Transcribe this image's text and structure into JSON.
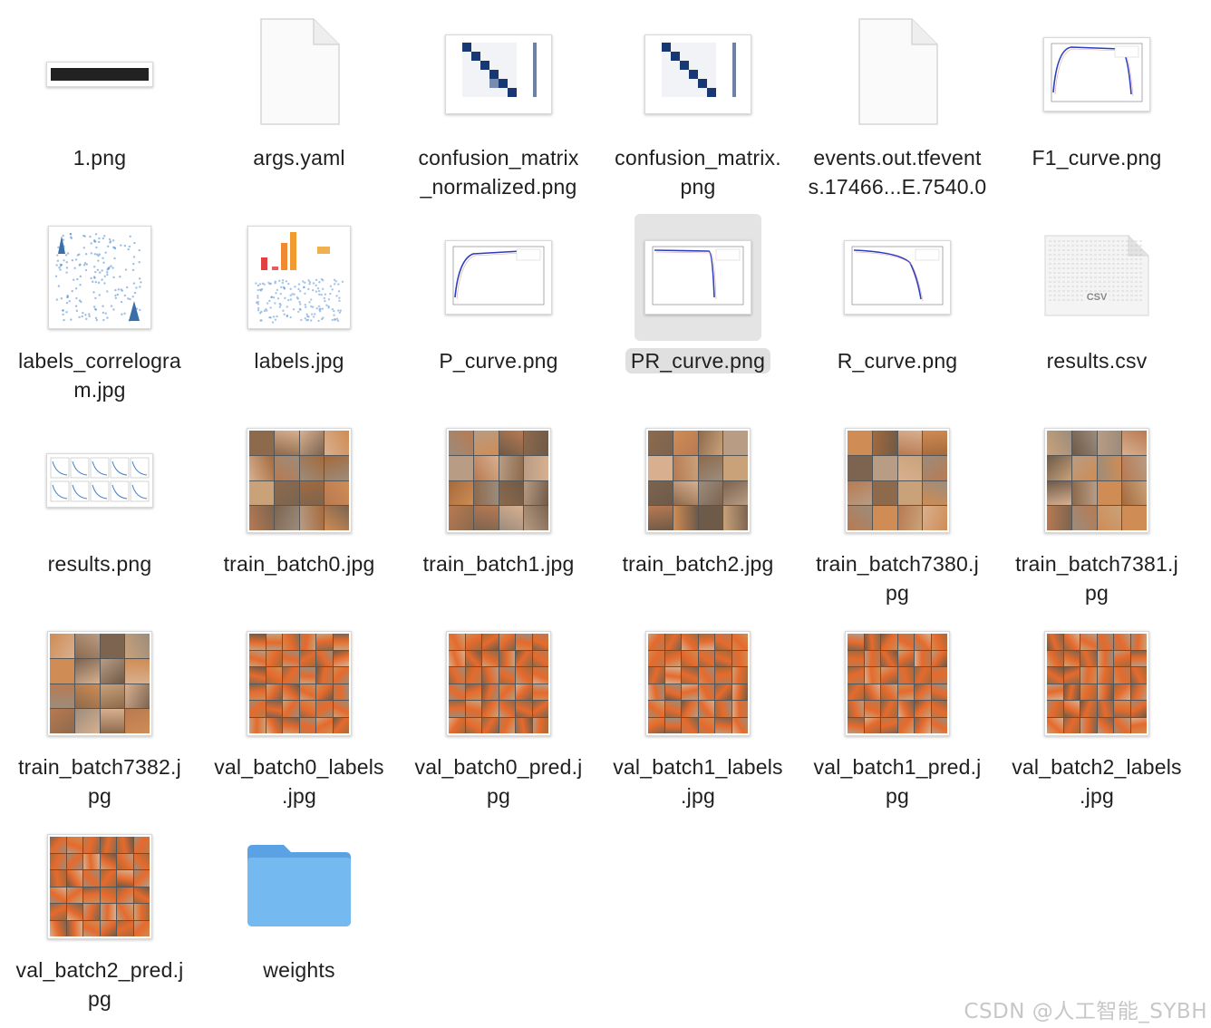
{
  "files": [
    {
      "name": "1.png",
      "label_lines": [
        "1.png"
      ],
      "kind": "image-strip"
    },
    {
      "name": "args.yaml",
      "label_lines": [
        "args.yaml"
      ],
      "kind": "document"
    },
    {
      "name": "confusion_matrix_normalized.png",
      "label_lines": [
        "confusion_matrix",
        "_normalized.png"
      ],
      "kind": "matrix"
    },
    {
      "name": "confusion_matrix.png",
      "label_lines": [
        "confusion_matrix.",
        "png"
      ],
      "kind": "matrix"
    },
    {
      "name": "events.out.tfevents.17466...E.7540.0",
      "label_lines": [
        "events.out.tfevent",
        "s.17466...E.7540.0"
      ],
      "kind": "document"
    },
    {
      "name": "F1_curve.png",
      "label_lines": [
        "F1_curve.png"
      ],
      "kind": "curve"
    },
    {
      "name": "labels_correlogram.jpg",
      "label_lines": [
        "labels_correlogra",
        "m.jpg"
      ],
      "kind": "correlogram"
    },
    {
      "name": "labels.jpg",
      "label_lines": [
        "labels.jpg"
      ],
      "kind": "labels"
    },
    {
      "name": "P_curve.png",
      "label_lines": [
        "P_curve.png"
      ],
      "kind": "curve"
    },
    {
      "name": "PR_curve.png",
      "label_lines": [
        "PR_curve.png"
      ],
      "kind": "curve",
      "selected": true
    },
    {
      "name": "R_curve.png",
      "label_lines": [
        "R_curve.png"
      ],
      "kind": "curve"
    },
    {
      "name": "results.csv",
      "label_lines": [
        "results.csv"
      ],
      "kind": "csv",
      "badge": "CSV"
    },
    {
      "name": "results.png",
      "label_lines": [
        "results.png"
      ],
      "kind": "results"
    },
    {
      "name": "train_batch0.jpg",
      "label_lines": [
        "train_batch0.jpg"
      ],
      "kind": "mosaic"
    },
    {
      "name": "train_batch1.jpg",
      "label_lines": [
        "train_batch1.jpg"
      ],
      "kind": "mosaic"
    },
    {
      "name": "train_batch2.jpg",
      "label_lines": [
        "train_batch2.jpg"
      ],
      "kind": "mosaic"
    },
    {
      "name": "train_batch7380.jpg",
      "label_lines": [
        "train_batch7380.j",
        "pg"
      ],
      "kind": "mosaic"
    },
    {
      "name": "train_batch7381.jpg",
      "label_lines": [
        "train_batch7381.j",
        "pg"
      ],
      "kind": "mosaic"
    },
    {
      "name": "train_batch7382.jpg",
      "label_lines": [
        "train_batch7382.j",
        "pg"
      ],
      "kind": "mosaic"
    },
    {
      "name": "val_batch0_labels.jpg",
      "label_lines": [
        "val_batch0_labels",
        ".jpg"
      ],
      "kind": "valgrid"
    },
    {
      "name": "val_batch0_pred.jpg",
      "label_lines": [
        "val_batch0_pred.j",
        "pg"
      ],
      "kind": "valgrid"
    },
    {
      "name": "val_batch1_labels.jpg",
      "label_lines": [
        "val_batch1_labels",
        ".jpg"
      ],
      "kind": "valgrid"
    },
    {
      "name": "val_batch1_pred.jpg",
      "label_lines": [
        "val_batch1_pred.j",
        "pg"
      ],
      "kind": "valgrid"
    },
    {
      "name": "val_batch2_labels.jpg",
      "label_lines": [
        "val_batch2_labels",
        ".jpg"
      ],
      "kind": "valgrid"
    },
    {
      "name": "val_batch2_pred.jpg",
      "label_lines": [
        "val_batch2_pred.j",
        "pg"
      ],
      "kind": "valgrid"
    },
    {
      "name": "weights",
      "label_lines": [
        "weights"
      ],
      "kind": "folder"
    }
  ],
  "watermark": "CSDN @人工智能_SYBH",
  "colors": {
    "folder": "#74b9f0",
    "folder_tab": "#5aa2e3",
    "matrix_dark": "#0b2d6b",
    "curve_line": "#2a3fbf",
    "selection": "#e0e0e0"
  }
}
